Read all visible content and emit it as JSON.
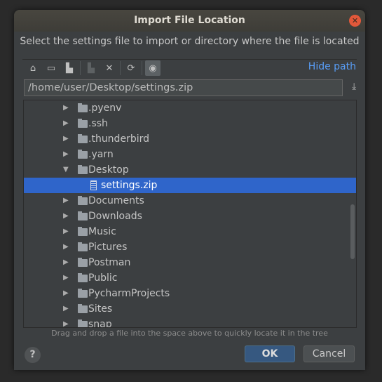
{
  "dialog": {
    "title": "Import File Location",
    "description": "Select the settings file to import or directory where the file is located"
  },
  "toolbar": {
    "icons": [
      "home-icon",
      "desktop-icon",
      "project-folder-icon",
      "new-folder-icon",
      "delete-icon",
      "refresh-icon",
      "show-hidden-icon"
    ],
    "hide_path": "Hide path"
  },
  "path": {
    "value": "/home/user/Desktop/settings.zip"
  },
  "tree": {
    "items": [
      {
        "label": ".pyenv",
        "type": "folder",
        "expanded": false
      },
      {
        "label": ".ssh",
        "type": "folder",
        "expanded": false
      },
      {
        "label": ".thunderbird",
        "type": "folder",
        "expanded": false
      },
      {
        "label": ".yarn",
        "type": "folder",
        "expanded": false
      },
      {
        "label": "Desktop",
        "type": "folder",
        "expanded": true
      },
      {
        "label": "settings.zip",
        "type": "zip",
        "selected": true
      },
      {
        "label": "Documents",
        "type": "folder",
        "expanded": false
      },
      {
        "label": "Downloads",
        "type": "folder",
        "expanded": false
      },
      {
        "label": "Music",
        "type": "folder",
        "expanded": false
      },
      {
        "label": "Pictures",
        "type": "folder",
        "expanded": false
      },
      {
        "label": "Postman",
        "type": "folder",
        "expanded": false
      },
      {
        "label": "Public",
        "type": "folder",
        "expanded": false
      },
      {
        "label": "PycharmProjects",
        "type": "folder",
        "expanded": false
      },
      {
        "label": "Sites",
        "type": "folder",
        "expanded": false
      },
      {
        "label": "snap",
        "type": "folder",
        "expanded": false
      }
    ]
  },
  "hint": "Drag and drop a file into the space above to quickly locate it in the tree",
  "buttons": {
    "help": "?",
    "ok": "OK",
    "cancel": "Cancel"
  },
  "colors": {
    "accent": "#589df6",
    "selection": "#2f65ca",
    "ok_button": "#365880"
  }
}
